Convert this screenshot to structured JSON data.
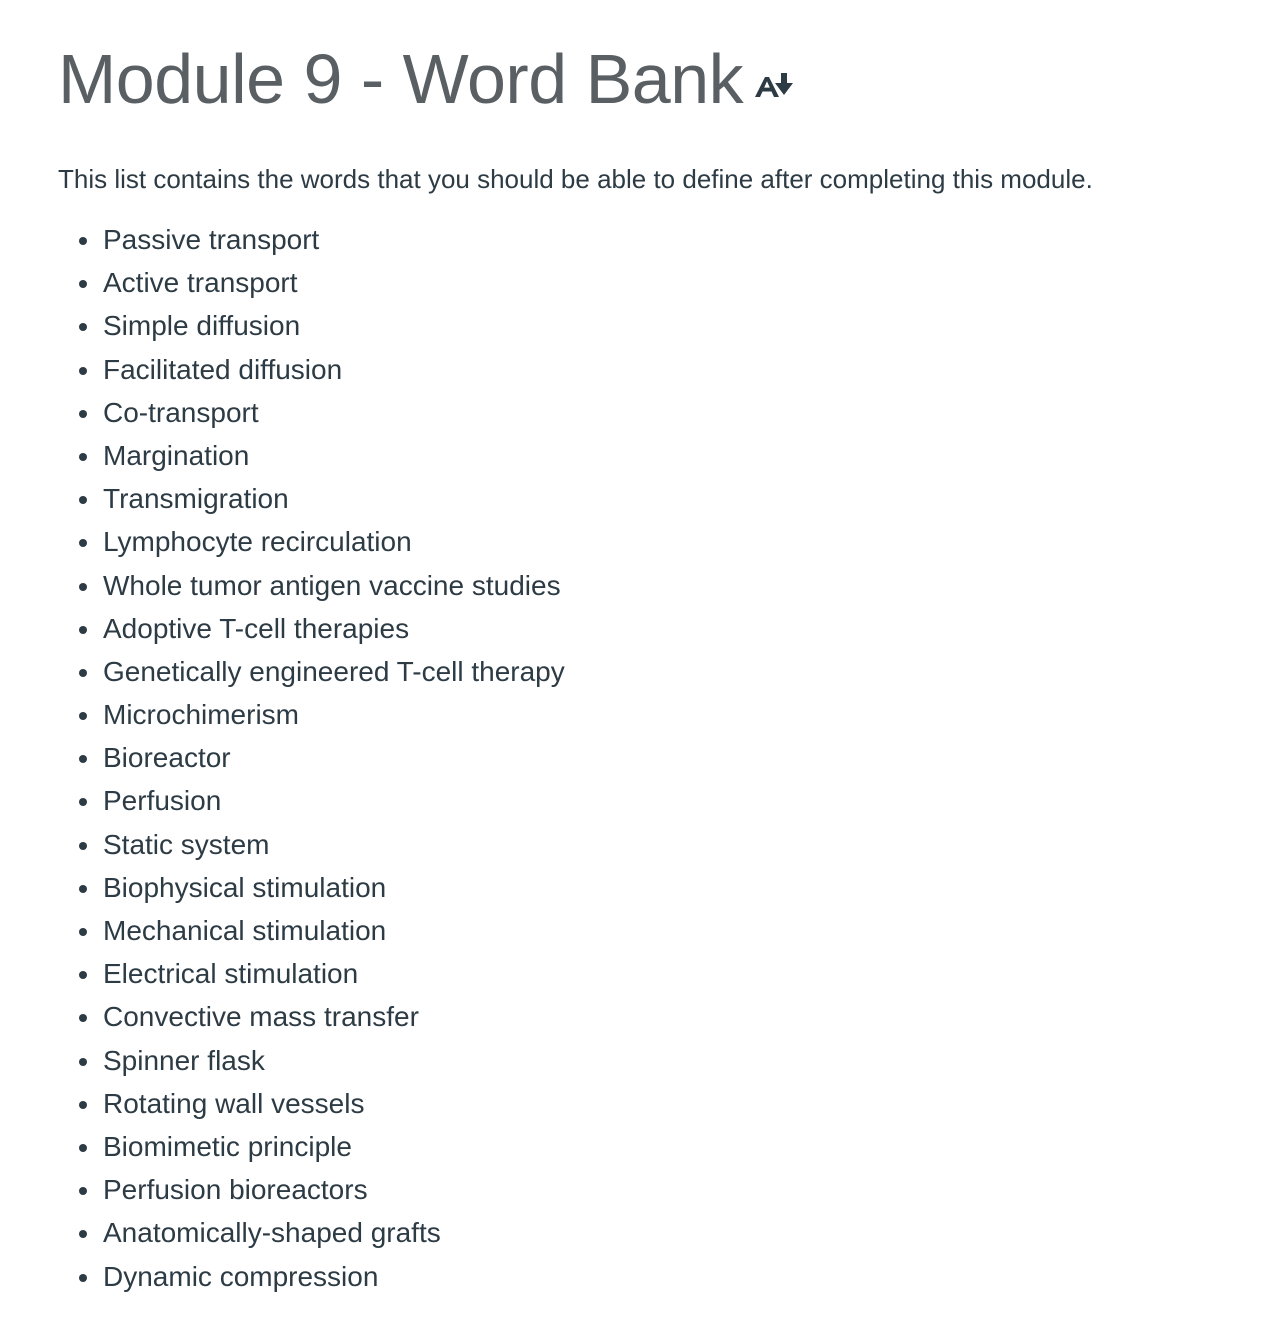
{
  "page": {
    "title": "Module 9 - Word Bank",
    "title_icon": "immersive-reader-icon",
    "intro": "This list contains the words that you should be able to define after completing this module.",
    "words": [
      "Passive transport",
      "Active transport",
      "Simple diffusion",
      "Facilitated diffusion",
      "Co-transport",
      "Margination",
      "Transmigration",
      "Lymphocyte recirculation",
      "Whole tumor antigen vaccine studies",
      "Adoptive T-cell therapies",
      "Genetically engineered T-cell therapy",
      "Microchimerism",
      "Bioreactor",
      "Perfusion",
      "Static system",
      "Biophysical stimulation",
      "Mechanical stimulation",
      "Electrical stimulation",
      "Convective mass transfer",
      "Spinner flask",
      "Rotating wall vessels",
      "Biomimetic principle",
      "Perfusion bioreactors",
      "Anatomically-shaped grafts",
      "Dynamic compression"
    ]
  },
  "colors": {
    "title": "#595f63",
    "text": "#2d3b45",
    "background": "#ffffff"
  }
}
